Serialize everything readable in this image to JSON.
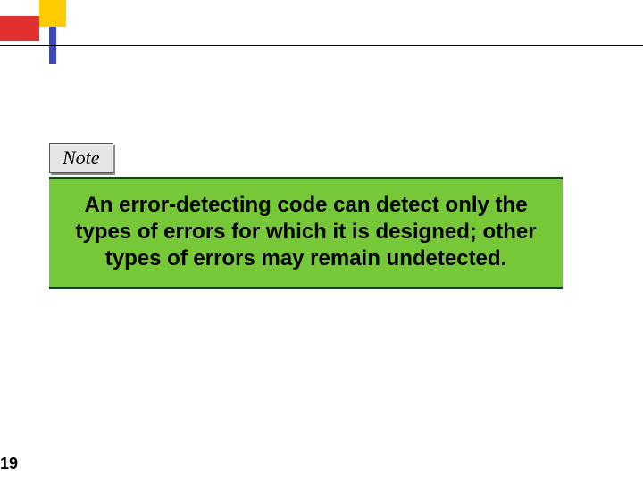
{
  "slide": {
    "note_label": "Note",
    "note_body": "An error-detecting code can detect only the types of errors for which it is designed; other types of errors may remain undetected.",
    "page_number": "19"
  }
}
